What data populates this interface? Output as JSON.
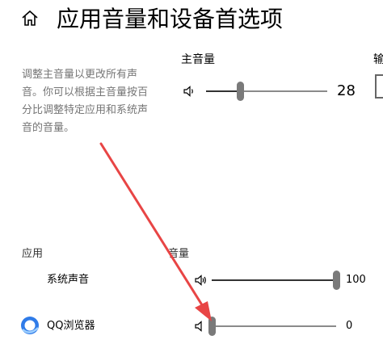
{
  "header": {
    "title": "应用音量和设备首选项",
    "home_icon": "home-icon"
  },
  "description": "调整主音量以更改所有声音。你可以根据主音量按百分比调整特定应用和系统声音的音量。",
  "master": {
    "label": "主音量",
    "value": 28,
    "value_text": "28",
    "icon": "speaker-low-icon"
  },
  "right_column": {
    "label_partial": "输"
  },
  "apps": {
    "column_apps": "应用",
    "column_volume": "音量",
    "items": [
      {
        "name": "系统声音",
        "value": 100,
        "value_text": "100",
        "icon": "speaker-high-icon"
      },
      {
        "name": "QQ浏览器",
        "value": 0,
        "value_text": "0",
        "icon": "speaker-low-icon",
        "app_icon": "qq-browser-icon"
      }
    ]
  },
  "colors": {
    "annotation_arrow": "#e84545",
    "thumb": "#7a7a7a",
    "qq_browser_brand": "#2f7be8"
  }
}
